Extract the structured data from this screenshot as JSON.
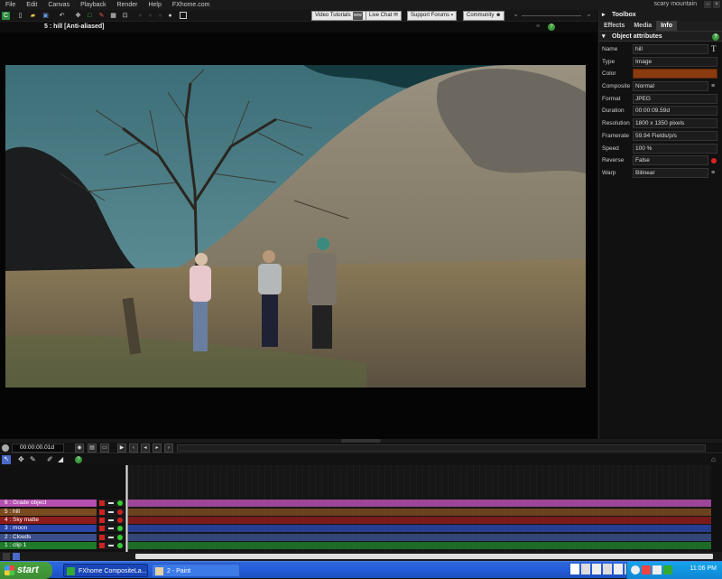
{
  "menu": {
    "items": [
      "File",
      "Edit",
      "Canvas",
      "Playback",
      "Render",
      "Help",
      "FXhome.com"
    ],
    "project_name": "scary mountain"
  },
  "toolbar": {
    "links": [
      {
        "label": "Video Tutorials",
        "badge": "new"
      },
      {
        "label": "Live Chat",
        "badge": ""
      },
      {
        "label": "Support Forums",
        "badge": ""
      },
      {
        "label": "Community",
        "badge": ""
      }
    ]
  },
  "viewer": {
    "layer_title": "5 : hill [Anti-aliased]"
  },
  "toolbox": {
    "title": "Toolbox",
    "tabs": [
      "Effects",
      "Media",
      "Info"
    ],
    "active_tab": "Info",
    "section_title": "Object attributes",
    "attributes": [
      {
        "label": "Name",
        "value": "hill"
      },
      {
        "label": "Type",
        "value": "Image"
      },
      {
        "label": "Color",
        "value": ""
      },
      {
        "label": "Composite",
        "value": "Normal"
      },
      {
        "label": "Format",
        "value": "JPEG"
      },
      {
        "label": "Duration",
        "value": "00:00:09.59d"
      },
      {
        "label": "Resolution",
        "value": "1800 x 1350 pixels"
      },
      {
        "label": "Framerate",
        "value": "59.94 Fields/p/s"
      },
      {
        "label": "Speed",
        "value": "100 %"
      },
      {
        "label": "Reverse",
        "value": "False"
      },
      {
        "label": "Warp",
        "value": "Bilinear"
      }
    ],
    "color_swatch": "#8a3b0f"
  },
  "transport": {
    "timecode": "00:00:00.01d"
  },
  "layers": [
    {
      "label": "6 : Grade object",
      "color": "#b54fb0"
    },
    {
      "label": "5 : hill",
      "color": "#7a4a20"
    },
    {
      "label": "4 : Sky matte",
      "color": "#8c1c1c"
    },
    {
      "label": "3 : moon",
      "color": "#2a44a8"
    },
    {
      "label": "2 : Clouds",
      "color": "#3a4e8a"
    },
    {
      "label": "1 : clip 1",
      "color": "#1e7a2a"
    }
  ],
  "taskbar": {
    "start_label": "start",
    "tasks": [
      "FXhome CompositeLa...",
      "2 - Paint"
    ],
    "clock": "11:06 PM"
  }
}
